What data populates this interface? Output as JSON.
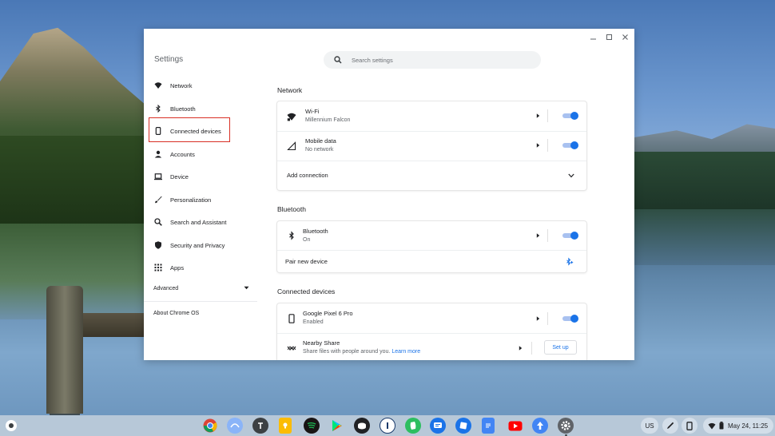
{
  "window": {
    "title": "Settings"
  },
  "search": {
    "placeholder": "Search settings"
  },
  "sidebar": {
    "items": [
      {
        "label": "Network",
        "icon": "wifi-icon"
      },
      {
        "label": "Bluetooth",
        "icon": "bluetooth-icon"
      },
      {
        "label": "Connected devices",
        "icon": "phone-icon"
      },
      {
        "label": "Accounts",
        "icon": "person-icon"
      },
      {
        "label": "Device",
        "icon": "laptop-icon"
      },
      {
        "label": "Personalization",
        "icon": "brush-icon"
      },
      {
        "label": "Search and Assistant",
        "icon": "search-icon"
      },
      {
        "label": "Security and Privacy",
        "icon": "shield-icon"
      },
      {
        "label": "Apps",
        "icon": "apps-grid-icon"
      }
    ],
    "advanced": "Advanced",
    "about": "About Chrome OS"
  },
  "sections": {
    "network": {
      "title": "Network",
      "wifi": {
        "title": "Wi-Fi",
        "subtitle": "Millennium Falcon",
        "enabled": true
      },
      "mobile": {
        "title": "Mobile data",
        "subtitle": "No network",
        "enabled": true
      },
      "add_connection": "Add connection"
    },
    "bluetooth": {
      "title": "Bluetooth",
      "bluetooth": {
        "title": "Bluetooth",
        "subtitle": "On",
        "enabled": true
      },
      "pair": "Pair new device"
    },
    "connected": {
      "title": "Connected devices",
      "phone": {
        "title": "Google Pixel 6 Pro",
        "subtitle": "Enabled",
        "enabled": true
      },
      "nearby": {
        "title": "Nearby Share",
        "subtitle": "Share files with people around you.",
        "link": "Learn more",
        "button": "Set up"
      }
    }
  },
  "shelf": {
    "apps": [
      "chrome",
      "app-2",
      "text-app",
      "keep",
      "spotify",
      "play-store",
      "app-7",
      "app-8",
      "evernote",
      "messages",
      "app-11",
      "docs",
      "youtube",
      "app-14",
      "settings"
    ],
    "locale": "US",
    "date_time": "May 24, 11:25"
  },
  "colors": {
    "accent": "#1a73e8",
    "highlight": "#d93025"
  }
}
